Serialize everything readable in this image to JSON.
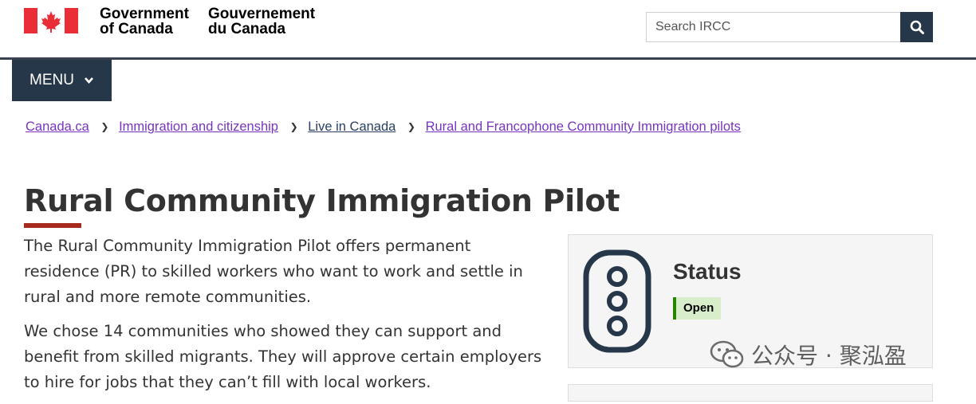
{
  "header": {
    "signature_en_line1": "Government",
    "signature_en_line2": "of Canada",
    "signature_fr_line1": "Gouvernement",
    "signature_fr_line2": "du Canada",
    "flag_icon": "canada-flag-icon",
    "search": {
      "placeholder": "Search IRCC",
      "value": "",
      "button_icon": "search-icon"
    }
  },
  "menu": {
    "label": "MENU",
    "icon": "chevron-down-icon"
  },
  "breadcrumb": [
    {
      "label": "Canada.ca",
      "visited": true
    },
    {
      "label": "Immigration and citizenship",
      "visited": true
    },
    {
      "label": "Live in Canada",
      "visited": false
    },
    {
      "label": "Rural and Francophone Community Immigration pilots",
      "visited": true
    }
  ],
  "page": {
    "title": "Rural Community Immigration Pilot",
    "paragraphs": [
      "The Rural Community Immigration Pilot offers permanent residence (PR) to skilled workers who want to work and settle in rural and more remote communities.",
      "We chose 14 communities who showed they can support and benefit from skilled migrants. They will approve certain employers to hire for jobs that they can’t fill with local workers."
    ]
  },
  "status_panel": {
    "title": "Status",
    "badge": "Open",
    "icon": "traffic-light-icon"
  },
  "watermark": {
    "text": "公众号 · 聚泓盈",
    "icon": "wechat-icon"
  },
  "colors": {
    "brand_dark": "#26374a",
    "title_bar": "#a62a1e",
    "link": "#284162",
    "visited_link": "#7834bc",
    "badge_bg": "#d8eeca",
    "badge_border": "#278400"
  }
}
